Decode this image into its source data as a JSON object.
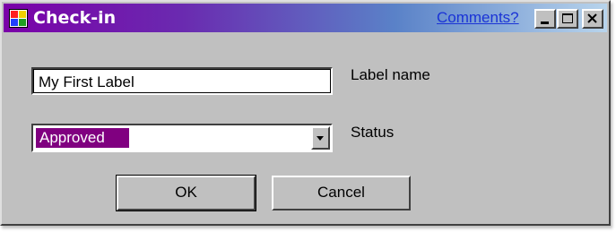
{
  "window": {
    "title": "Check-in",
    "comments_link": "Comments?",
    "title_gradient_start": "#7a00a8",
    "title_gradient_end": "#b8d4ec"
  },
  "form": {
    "label_name": {
      "value": "My First Label",
      "caption": "Label name"
    },
    "status": {
      "selected": "Approved",
      "caption": "Status",
      "selection_highlight": "#800080"
    }
  },
  "buttons": {
    "ok": "OK",
    "cancel": "Cancel"
  },
  "icons": {
    "app": "app-window-icon",
    "minimize": "minimize-icon",
    "maximize": "maximize-icon",
    "close": "close-icon",
    "dropdown": "chevron-down-icon"
  }
}
